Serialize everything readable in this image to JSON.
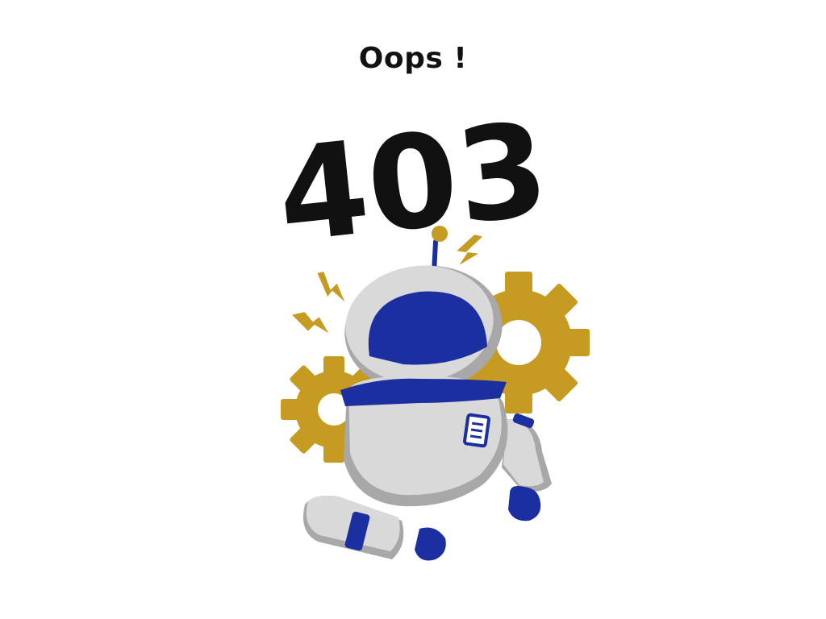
{
  "headline": "Oops !",
  "error_code": "403",
  "colors": {
    "background": "#ffffff",
    "text": "#111111",
    "gear": "#c69b22",
    "bolt": "#c69b22",
    "robot_blue": "#1c2fa0",
    "robot_body": "#d9d9d9",
    "robot_shadow": "#a8a8a8",
    "outline": "#ffffff"
  },
  "icons": [
    "gear-icon",
    "lightning-bolt-icon",
    "robot-illustration"
  ]
}
